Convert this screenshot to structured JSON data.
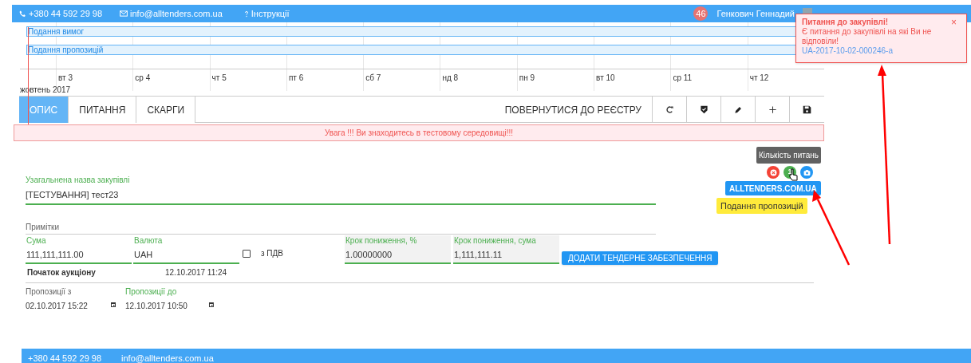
{
  "top_bar": {
    "phone": "+380 44 592 29 98",
    "email": "info@alltenders.com.ua",
    "help": "Інструкції",
    "notifications_count": "46",
    "user": "Генкович Геннадий"
  },
  "notification": {
    "title": "Питання до закупівлі!",
    "message": "Є питання до закупівлі на які Ви не відповіли!",
    "link": "UA-2017-10-02-000246-a",
    "close": "×"
  },
  "timeline": {
    "bars": [
      "Подання вимог",
      "Подання пропозицій"
    ],
    "days": [
      "вт 3",
      "ср 4",
      "чт 5",
      "пт 6",
      "сб 7",
      "нд 8",
      "пн 9",
      "вт 10",
      "ср 11",
      "чт 12"
    ],
    "month": "жовтень 2017"
  },
  "tabs": [
    {
      "label": "ОПИС",
      "selected": true
    },
    {
      "label": "ПИТАННЯ",
      "selected": false
    },
    {
      "label": "СКАРГИ",
      "selected": false
    }
  ],
  "back_button": "ПОВЕРНУТИСЯ ДО РЕЄСТРУ",
  "toolbar": [
    {
      "kind": "refresh"
    },
    {
      "kind": "shield"
    },
    {
      "kind": "edit"
    },
    {
      "kind": "add"
    },
    {
      "kind": "save"
    }
  ],
  "warning": "Увага !!! Ви знаходитесь в тестовому середовищі!!!",
  "tooltip": "Кількість питань",
  "status_icons": [
    {
      "kind": "cancel",
      "color": "#f44336"
    },
    {
      "kind": "count",
      "label": "1",
      "color": "#4caf50"
    },
    {
      "kind": "camera",
      "color": "#2196f3"
    }
  ],
  "site_button": "ALLTENDERS.COM.UA",
  "stage_badge": "Подання пропозицій",
  "form": {
    "title": {
      "label": "Узагальнена назва закупівлі",
      "value": "[ТЕСТУВАННЯ] тест23"
    },
    "notes_label": "Примітки",
    "amount": {
      "label": "Сума",
      "value": "111,111,111.00"
    },
    "currency": {
      "label": "Валюта",
      "value": "UAH"
    },
    "vat": {
      "label": "з ПДВ",
      "checked": false
    },
    "step_percent": {
      "label": "Крок пониження, %",
      "value": "1.00000000",
      "disabled": true
    },
    "step_amount": {
      "label": "Крок пониження, сума",
      "value": "1,111,111.11",
      "disabled": true
    },
    "guarantee_button": "ДОДАТИ ТЕНДЕРНЕ ЗАБЕЗПЕЧЕННЯ",
    "auction_start": {
      "label": "Початок аукціону",
      "value": "12.10.2017 11:24"
    },
    "offers_from": {
      "label": "Пропозиції з",
      "value": "02.10.2017 15:22"
    },
    "offers_to": {
      "label": "Пропозиції до",
      "value": "12.10.2017 10:50"
    }
  },
  "footer": {
    "phone": "+380 44 592 29 98",
    "email": "info@alltenders.com.ua"
  }
}
